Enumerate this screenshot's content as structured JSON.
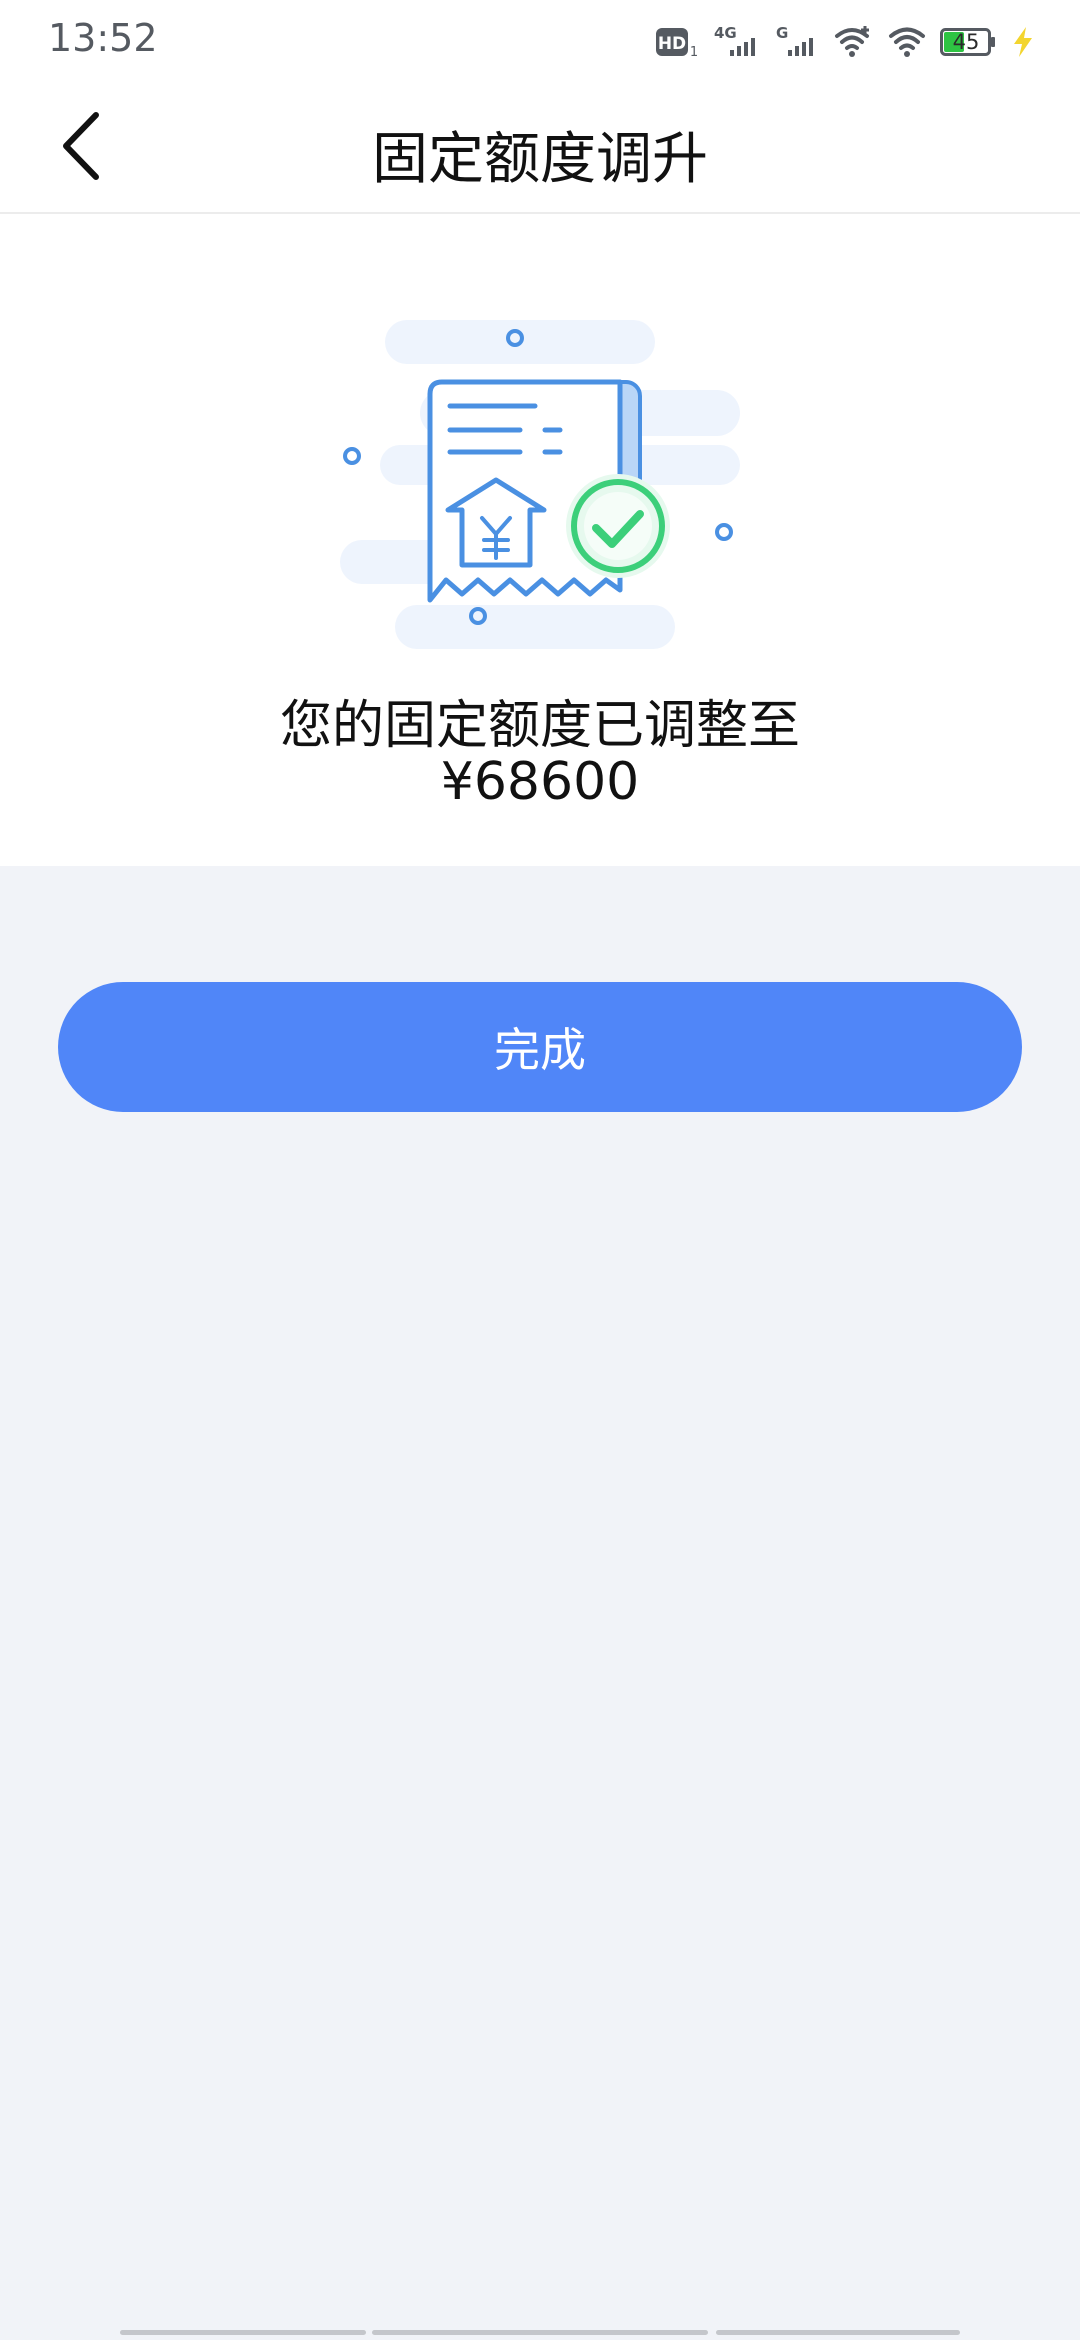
{
  "status_bar": {
    "time": "13:52",
    "hd_label": "HD",
    "hd_sub": "1",
    "net1": "4G",
    "net2": "G",
    "battery_level": "45",
    "battery_color": "#2ec443",
    "charging_color": "#f3d52f"
  },
  "header": {
    "title": "固定额度调升",
    "back_icon": "chevron-left-icon"
  },
  "result": {
    "message": "您的固定额度已调整至",
    "amount": "¥68600",
    "illustration": "receipt-check-illustration"
  },
  "actions": {
    "done_label": "完成",
    "done_color": "#5086f8"
  },
  "colors": {
    "accent": "#5086f8",
    "background": "#f1f3f8",
    "illustration_blue": "#4a90e2",
    "illustration_green": "#3ccf7a"
  }
}
